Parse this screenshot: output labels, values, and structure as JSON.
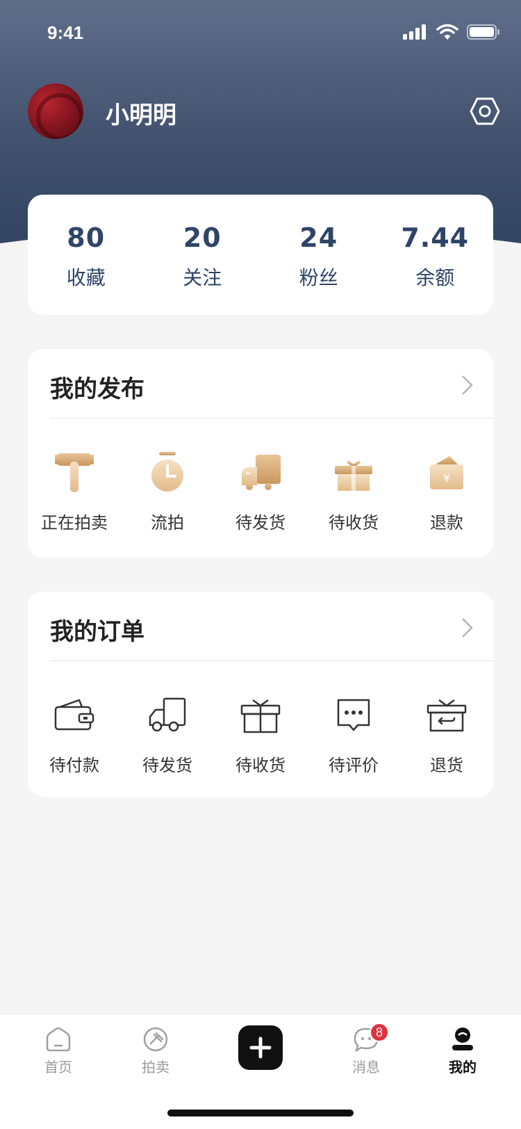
{
  "status_bar": {
    "time": "9:41"
  },
  "profile": {
    "username": "小明明"
  },
  "stats": [
    {
      "value": "80",
      "label": "收藏"
    },
    {
      "value": "20",
      "label": "关注"
    },
    {
      "value": "24",
      "label": "粉丝"
    },
    {
      "value": "7.44",
      "label": "余额"
    }
  ],
  "publish": {
    "title": "我的发布",
    "items": [
      {
        "label": "正在拍卖",
        "icon": "auction-hammer-icon"
      },
      {
        "label": "流拍",
        "icon": "stopwatch-icon"
      },
      {
        "label": "待发货",
        "icon": "truck-icon"
      },
      {
        "label": "待收货",
        "icon": "gift-icon"
      },
      {
        "label": "退款",
        "icon": "refund-wallet-icon"
      }
    ]
  },
  "orders": {
    "title": "我的订单",
    "items": [
      {
        "label": "待付款",
        "icon": "wallet-icon"
      },
      {
        "label": "待发货",
        "icon": "truck-icon"
      },
      {
        "label": "待收货",
        "icon": "gift-icon"
      },
      {
        "label": "待评价",
        "icon": "comment-icon"
      },
      {
        "label": "退货",
        "icon": "return-box-icon"
      }
    ]
  },
  "tabbar": {
    "items": [
      {
        "label": "首页",
        "icon": "home-icon"
      },
      {
        "label": "拍卖",
        "icon": "auction-icon"
      },
      {
        "label": "",
        "icon": "plus-icon"
      },
      {
        "label": "消息",
        "icon": "message-icon",
        "badge": "8"
      },
      {
        "label": "我的",
        "icon": "profile-icon",
        "active": true
      }
    ]
  },
  "colors": {
    "header_top": "#5f6e89",
    "header_bottom": "#324462",
    "stat_text": "#2f4468",
    "badge": "#e0313b",
    "gold": "#d4a574"
  }
}
